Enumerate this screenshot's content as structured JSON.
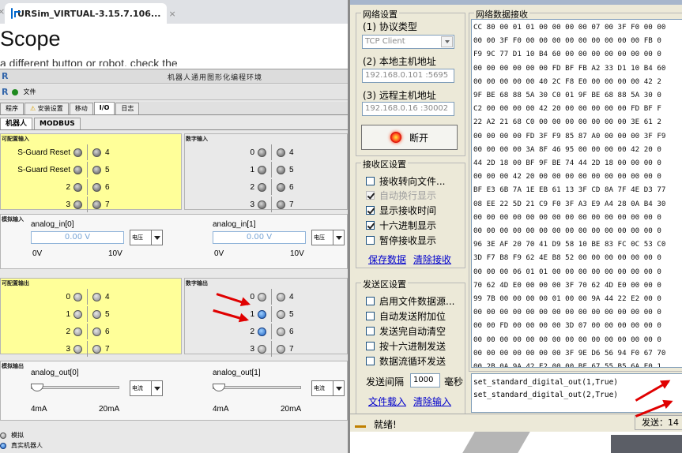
{
  "browser": {
    "tab_title": "URSim_VIRTUAL-3.15.7.106...",
    "tab_close": "×",
    "heading": "Scope",
    "subtext": "a different button or robot, check the"
  },
  "ursim": {
    "logo": "R",
    "title": "机器人通用图形化编程环境",
    "menu_file": "文件",
    "tabs": [
      "程序",
      "安装设置",
      "移动",
      "I/O",
      "日志"
    ],
    "subtabs": [
      "机器人",
      "MODBUS"
    ],
    "config_input": {
      "title": "可配置输入",
      "rows": [
        {
          "label": "S-Guard Reset",
          "num": "4"
        },
        {
          "label": "S-Guard Reset",
          "num": "5"
        },
        {
          "label": "2",
          "num": "6"
        },
        {
          "label": "3",
          "num": "7"
        }
      ]
    },
    "digital_input": {
      "title": "数字输入",
      "rows": [
        {
          "a": "0",
          "b": "4"
        },
        {
          "a": "1",
          "b": "5"
        },
        {
          "a": "2",
          "b": "6"
        },
        {
          "a": "3",
          "b": "7"
        }
      ]
    },
    "analog_input": {
      "title": "模拟输入",
      "in0": {
        "name": "analog_in[0]",
        "value": "0.00 V",
        "mode": "电压",
        "min": "0V",
        "max": "10V"
      },
      "in1": {
        "name": "analog_in[1]",
        "value": "0.00 V",
        "mode": "电压",
        "min": "0V",
        "max": "10V"
      }
    },
    "config_output": {
      "title": "可配置输出",
      "rows": [
        {
          "a": "0",
          "b": "4"
        },
        {
          "a": "1",
          "b": "5"
        },
        {
          "a": "2",
          "b": "6"
        },
        {
          "a": "3",
          "b": "7"
        }
      ]
    },
    "digital_output": {
      "title": "数字输出",
      "rows": [
        {
          "a": "0",
          "b": "4"
        },
        {
          "a": "1",
          "b": "5"
        },
        {
          "a": "2",
          "b": "6"
        },
        {
          "a": "3",
          "b": "7"
        }
      ]
    },
    "analog_output": {
      "title": "模拟输出",
      "out0": {
        "name": "analog_out[0]",
        "mode": "电流",
        "min": "4mA",
        "max": "20mA"
      },
      "out1": {
        "name": "analog_out[1]",
        "mode": "电流",
        "min": "4mA",
        "max": "20mA"
      }
    },
    "mode_sim": "模拟",
    "mode_real": "真实机器人"
  },
  "serial": {
    "net_settings": "网络设置",
    "protocol_label": "(1) 协议类型",
    "protocol_value": "TCP Client",
    "local_label": "(2) 本地主机地址",
    "local_value": "192.168.0.101 :5695",
    "remote_label": "(3) 远程主机地址",
    "remote_value": "192.168.0.16 :30002",
    "disconnect": "断开",
    "recv_settings": "接收区设置",
    "recv_opts": [
      {
        "label": "接收转向文件...",
        "checked": false,
        "disabled": false
      },
      {
        "label": "自动换行显示",
        "checked": true,
        "disabled": true
      },
      {
        "label": "显示接收时间",
        "checked": true,
        "disabled": false
      },
      {
        "label": "十六进制显示",
        "checked": true,
        "disabled": false
      },
      {
        "label": "暂停接收显示",
        "checked": false,
        "disabled": false
      }
    ],
    "save_data": "保存数据",
    "clear_recv": "清除接收",
    "send_settings": "发送区设置",
    "send_opts": [
      "启用文件数据源...",
      "自动发送附加位",
      "发送完自动清空",
      "按十六进制发送",
      "数据流循环发送"
    ],
    "interval_label": "发送间隔",
    "interval_value": "1000",
    "interval_unit": "毫秒",
    "file_load": "文件载入",
    "clear_input": "清除输入",
    "recv_title": "网络数据接收",
    "hex_lines": [
      "CC 80 00 01 01 00 00 00 00 07 00 3F F0 00 00",
      "00 00 3F F0 00 00 00 00 00 00 00 00 00 FB 0",
      "F9 9C 77 D1 10 B4 60 00 00 00 00 00 00 00 0",
      "00 00 00 00 00 00 FD BF FB A2 33 D1 10 B4 60",
      "00 00 00 00 00 40 2C F8 E0 00 00 00 00 42 2",
      "9F BE 68 88 5A 30 C0 01 9F BE 68 88 5A 30 0",
      "C2 00 00 00 00 42 20 00 00 00 00 00 FD BF F",
      "22 A2 21 68 C0 00 00 00 00 00 00 00 3E 61 2",
      "00 00 00 00 FD 3F F9 85 87 A0 00 00 00 3F F9",
      "00 00 00 00 3A 8F 46 95 00 00 00 00 42 20 0",
      "44 2D 18 00 BF 9F BE 74 44 2D 18 00 00 00 0",
      "00 00 00 42 20 00 00 00 00 00 00 00 00 00 0",
      "BF E3 6B 7A 1E EB 61 13 3F CD 8A 7F 4E D3 77",
      "08 EE 22 5D 21 C9 F0 3F A3 E9 A4 28 0A B4 30",
      "00 00 00 00 00 00 00 00 00 00 00 00 00 00 0",
      "00 00 00 00 00 00 00 00 00 00 00 00 00 00 0",
      "96 3E AF 20 70 41 D9 58 10 BE 83 FC 0C 53 C0",
      "3D F7 B8 F9 62 4E B8 52 00 00 00 00 00 00 0",
      "00 00 00 06 01 01 00 00 00 00 00 00 00 00 0",
      "70 62 4D E0 00 00 00 3F 70 62 4D E0 00 00 0",
      "99 7B 00 00 00 00 01 00 00 9A 44 22 E2 00 0",
      "00 00 00 00 00 00 00 00 00 00 00 00 00 00 0",
      "00 00 FD 00 00 00 00 3D 07 00 00 00 00 00 0",
      "00 00 00 00 00 00 00 00 00 00 00 00 00 00 0",
      "00 00 00 00 00 00 00 3F 9E D6 56 94 F0 67 70",
      "00 2B 0A 9A 42 E2 00 00 BF 67 55 B5 6A E0 1",
      "3F E7 6B 3A 5C 8B 75 B4 00 00 00 00 00 00 0"
    ],
    "send_lines": [
      "set_standard_digital_out(1,True)",
      "set_standard_digital_out(2,True)"
    ],
    "status": "就绪!",
    "send_count": "发送：14"
  }
}
